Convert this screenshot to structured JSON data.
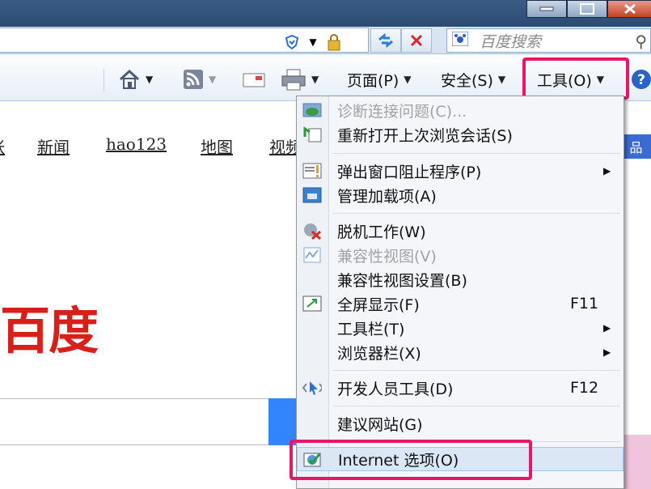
{
  "browser": {
    "search_placeholder": "百度搜索",
    "commands": {
      "page": "页面(P)",
      "safety": "安全(S)",
      "tools": "工具(O)"
    }
  },
  "page_behind": {
    "nav_links": [
      "新闻",
      "hao123",
      "地图",
      "视频"
    ],
    "logo_text": "百度",
    "right_label": "品",
    "partial_left": "张"
  },
  "tools_menu": {
    "items": [
      {
        "label": "诊断连接问题(C)...",
        "disabled": true,
        "icon": "network-diagnose-icon"
      },
      {
        "label": "重新打开上次浏览会话(S)",
        "disabled": false,
        "icon": "reopen-session-icon"
      },
      {
        "label": "弹出窗口阻止程序(P)",
        "disabled": false,
        "icon": "popup-blocker-icon",
        "submenu": true
      },
      {
        "label": "管理加载项(A)",
        "disabled": false,
        "icon": "manage-addons-icon"
      },
      {
        "label": "脱机工作(W)",
        "disabled": false,
        "icon": "work-offline-icon"
      },
      {
        "label": "兼容性视图(V)",
        "disabled": true,
        "icon": "compat-view-icon"
      },
      {
        "label": "兼容性视图设置(B)",
        "disabled": false
      },
      {
        "label": "全屏显示(F)",
        "disabled": false,
        "icon": "fullscreen-icon",
        "shortcut": "F11"
      },
      {
        "label": "工具栏(T)",
        "disabled": false,
        "submenu": true
      },
      {
        "label": "浏览器栏(X)",
        "disabled": false,
        "submenu": true
      },
      {
        "label": "开发人员工具(D)",
        "disabled": false,
        "icon": "developer-tools-icon",
        "shortcut": "F12"
      },
      {
        "label": "建议网站(G)",
        "disabled": false
      },
      {
        "label": "Internet 选项(O)",
        "disabled": false,
        "icon": "internet-options-icon"
      }
    ]
  },
  "colors": {
    "highlight": "#e8166a",
    "baidu_red": "#d8201a"
  }
}
